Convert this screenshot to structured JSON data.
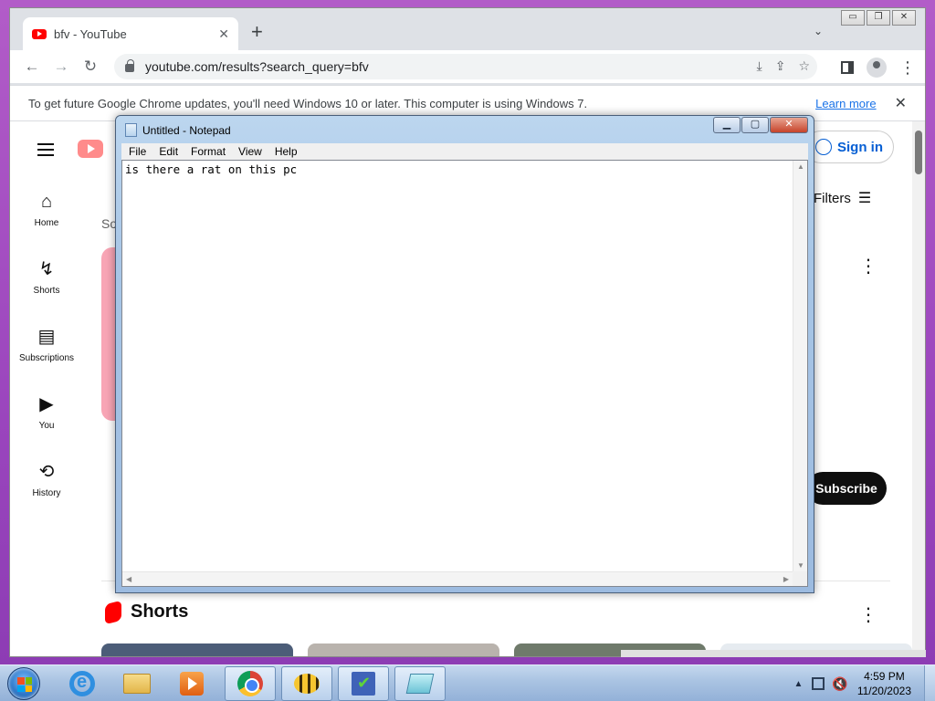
{
  "chrome": {
    "tab_title": "bfv - YouTube",
    "tab_close": "✕",
    "new_tab": "+",
    "tab_search": "⌄",
    "window_buttons": {
      "minimize": "▭",
      "restore": "❐",
      "close": "✕"
    },
    "back": "←",
    "forward": "→",
    "reload": "↻",
    "url": "youtube.com/results?search_query=bfv",
    "omni_icons": {
      "install": "⤓",
      "share": "⇪",
      "bookmark": "☆"
    },
    "menu_dots": "⋮",
    "infobar_message": "To get future Google Chrome updates, you'll need Windows 10 or later. This computer is using Windows 7.",
    "infobar_link": "Learn more",
    "infobar_close": "✕"
  },
  "youtube": {
    "nav": [
      {
        "label": "Home",
        "icon": "home-icon",
        "glyph": "⌂"
      },
      {
        "label": "Shorts",
        "icon": "shorts-icon",
        "glyph": "↯"
      },
      {
        "label": "Subscriptions",
        "icon": "subscriptions-icon",
        "glyph": "▤"
      },
      {
        "label": "You",
        "icon": "you-icon",
        "glyph": "▶"
      },
      {
        "label": "History",
        "icon": "history-icon",
        "glyph": "⟲"
      }
    ],
    "sign_in": "Sign in",
    "filters": "Filters",
    "filters_icon": "☰",
    "sort_label_partial": "So",
    "kebab": "⋮",
    "subscribe": "Subscribe",
    "shorts_title": "Shorts",
    "thumb_colors": [
      "#4c5d78",
      "#b9b3ad",
      "#6f7a6b",
      "#e6ebf0"
    ]
  },
  "notepad": {
    "title": "Untitled - Notepad",
    "menu": [
      "File",
      "Edit",
      "Format",
      "View",
      "Help"
    ],
    "content": "is there a rat on this pc",
    "btn_min": "▁",
    "btn_max": "▢",
    "btn_close": "✕",
    "arrow_up": "▲",
    "arrow_down": "▼",
    "arrow_left": "◀",
    "arrow_right": "▶"
  },
  "taskbar": {
    "apps": [
      "internet-explorer",
      "windows-explorer",
      "media-player",
      "google-chrome",
      "bee-app",
      "checker-app",
      "notepad"
    ],
    "tray_up": "▲",
    "volume": "🔇",
    "time": "4:59 PM",
    "date": "11/20/2023"
  }
}
